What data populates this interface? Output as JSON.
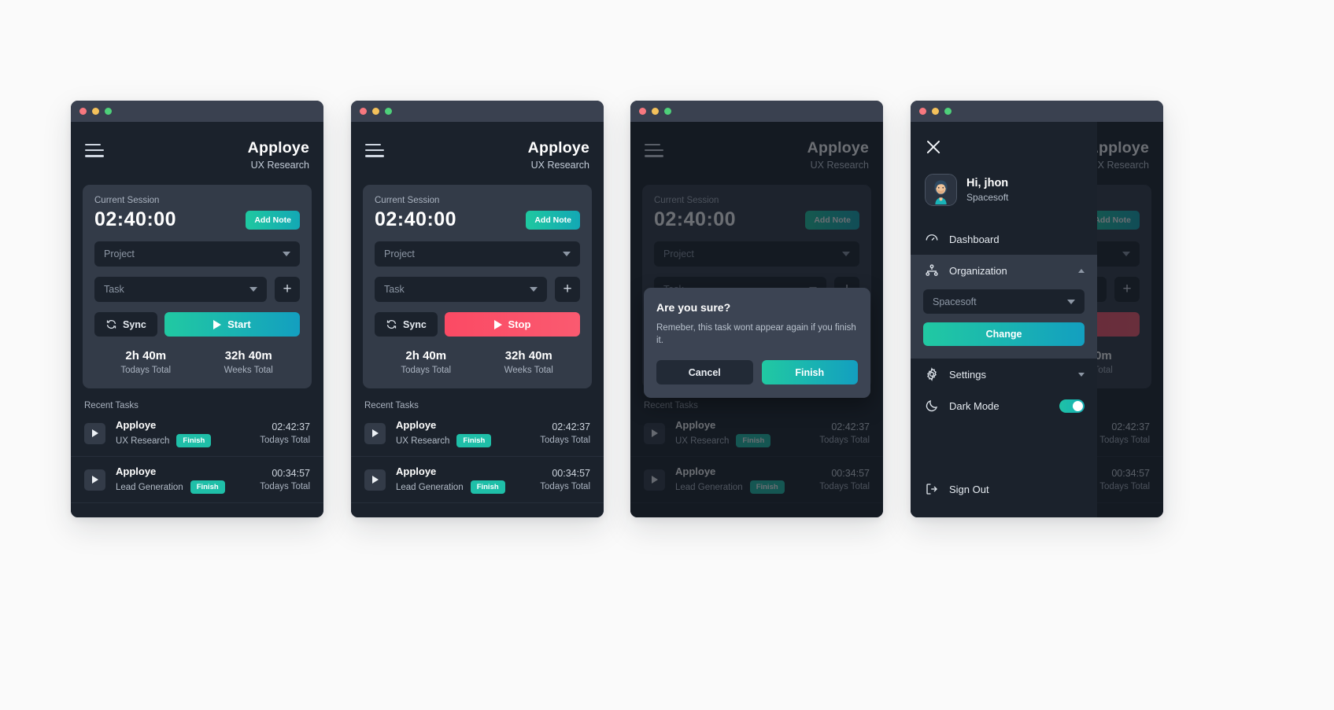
{
  "app": {
    "brand": "Apploye",
    "subtitle": "UX Research"
  },
  "session": {
    "label": "Current Session",
    "timer": "02:40:00",
    "add_note": "Add Note",
    "project_placeholder": "Project",
    "task_placeholder": "Task",
    "add_task_icon": "+",
    "sync_label": "Sync",
    "start_label": "Start",
    "stop_label": "Stop",
    "totals": [
      {
        "value": "2h 40m",
        "label": "Todays Total"
      },
      {
        "value": "32h 40m",
        "label": "Weeks Total"
      }
    ]
  },
  "recent": {
    "title": "Recent Tasks",
    "items": [
      {
        "name": "Apploye",
        "project": "UX Research",
        "chip": "Finish",
        "time": "02:42:37",
        "time_label": "Todays Total"
      },
      {
        "name": "Apploye",
        "project": "Lead Generation",
        "chip": "Finish",
        "time": "00:34:57",
        "time_label": "Todays Total"
      }
    ]
  },
  "modal": {
    "title": "Are you sure?",
    "text": "Remeber, this task wont appear again if you finish it.",
    "cancel": "Cancel",
    "finish": "Finish"
  },
  "drawer": {
    "close_icon": "close-icon",
    "greeting": "Hi, jhon",
    "org": "Spacesoft",
    "menu": [
      {
        "label": "Dashboard",
        "icon": "dashboard-icon"
      },
      {
        "label": "Organization",
        "icon": "organization-icon"
      },
      {
        "label": "Settings",
        "icon": "gear-icon"
      },
      {
        "label": "Dark Mode",
        "icon": "moon-icon"
      }
    ],
    "org_select_value": "Spacesoft",
    "change_label": "Change",
    "sign_out": "Sign Out",
    "sign_out_icon": "sign-out-icon",
    "dark_mode_on": true
  },
  "colors": {
    "accent_teal": "#1fc8a0",
    "accent_cyan": "#139fc0",
    "danger": "#fb4a64",
    "chip": "#1fbfa8",
    "card_bg": "#333b48",
    "app_bg": "#1b222c"
  }
}
